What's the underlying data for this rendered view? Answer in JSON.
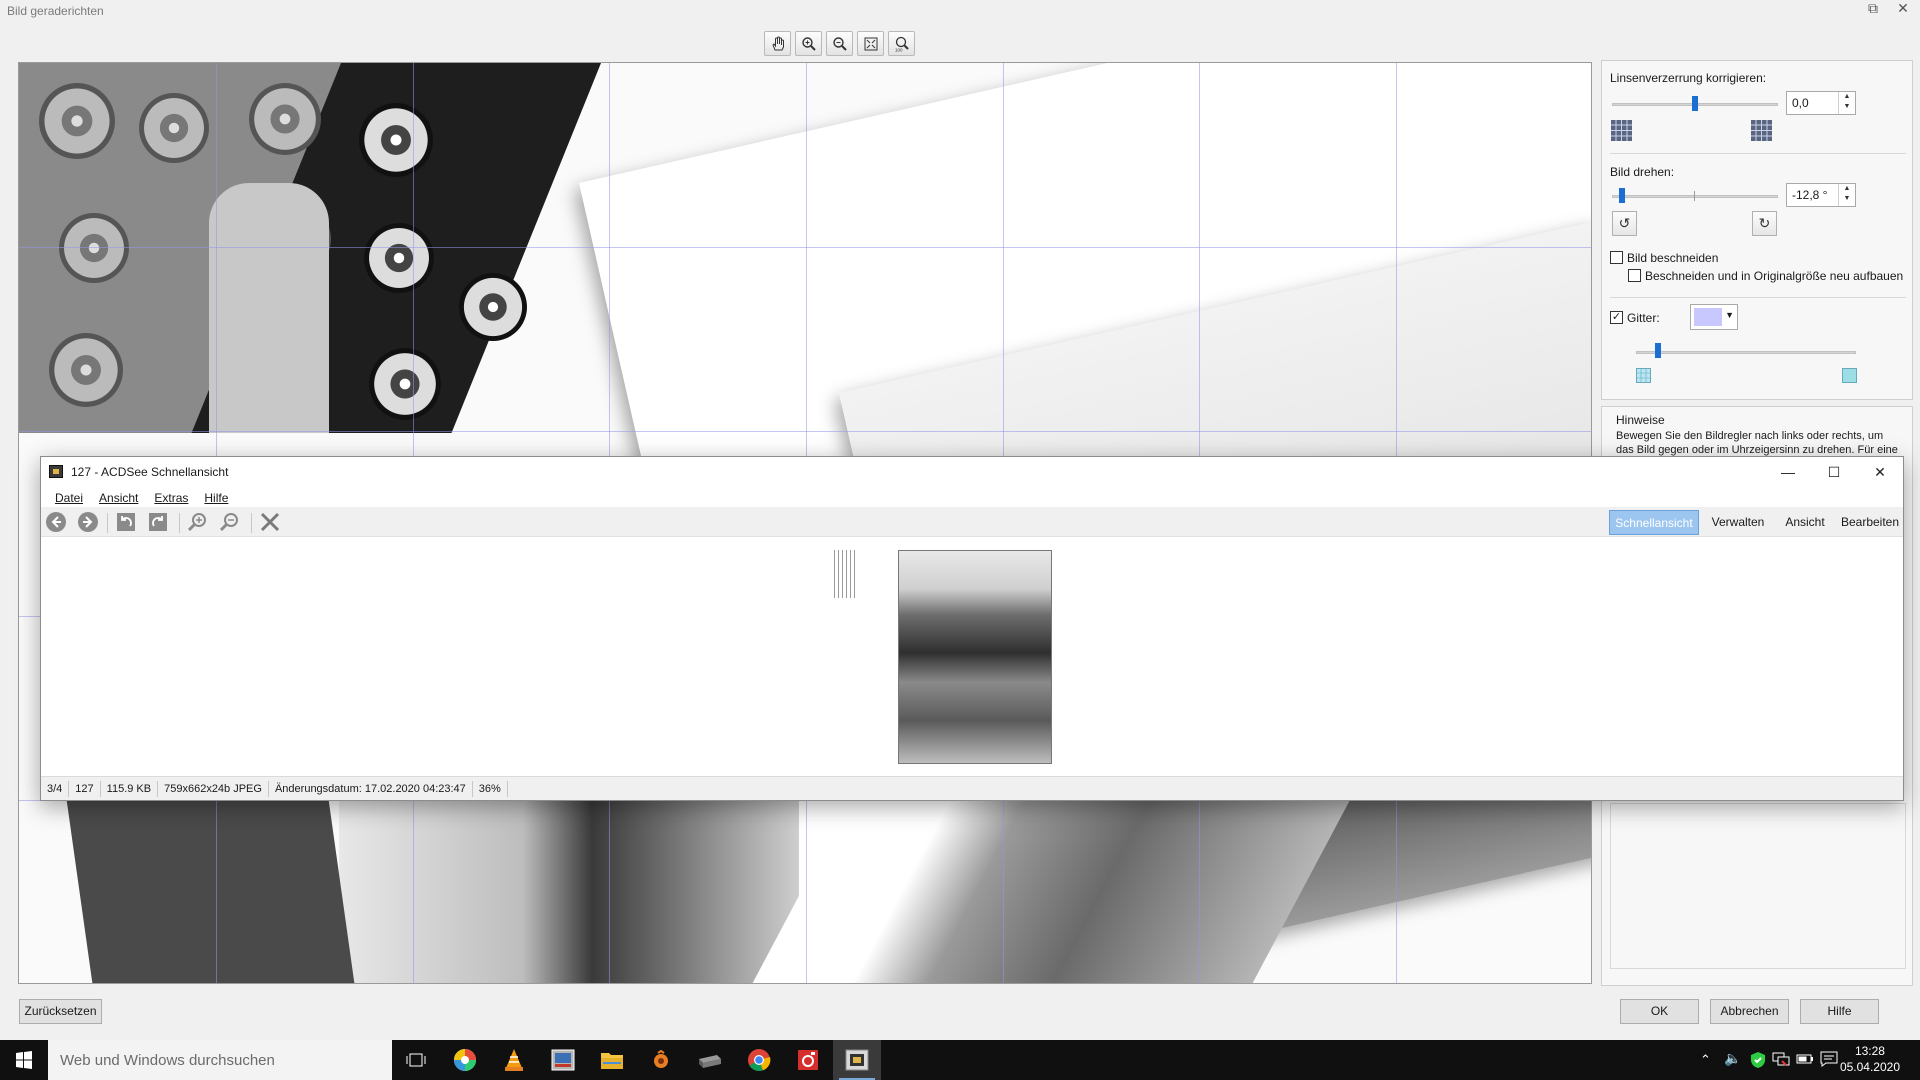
{
  "dialog": {
    "title": "Bild geraderichten",
    "window_buttons": [
      "restore",
      "close"
    ],
    "view_tools": [
      "hand-icon",
      "zoom-in-icon",
      "zoom-out-icon",
      "fit-icon",
      "actual-size-icon"
    ]
  },
  "settings": {
    "lens_label": "Linsenverzerrung korrigieren:",
    "lens_value": "0,0",
    "lens_slider": 0.5,
    "rotate_label": "Bild drehen:",
    "rotate_value": "-12,8 °",
    "rotate_slider": 0.06,
    "crop_label": "Bild beschneiden",
    "crop_checked": false,
    "crop_restore_label": "Beschneiden und in Originalgröße neu aufbauen",
    "crop_restore_checked": false,
    "grid_label": "Gitter:",
    "grid_checked": true,
    "grid_color": "#c8c8ff",
    "grid_slider": 0.1
  },
  "hints": {
    "title": "Hinweise",
    "text": "Bewegen Sie den Bildregler nach links oder rechts, um das Bild gegen oder im Uhrzeigersinn zu drehen. Für eine"
  },
  "buttons": {
    "reset": "Zurücksetzen",
    "ok": "OK",
    "cancel": "Abbrechen",
    "help": "Hilfe"
  },
  "acdsee": {
    "title": "127 - ACDSee Schnellansicht",
    "menu": [
      "Datei",
      "Ansicht",
      "Extras",
      "Hilfe"
    ],
    "tabs": [
      "Schnellansicht",
      "Verwalten",
      "Ansicht",
      "Bearbeiten"
    ],
    "active_tab": "Schnellansicht",
    "status": [
      "3/4",
      "127",
      "115.9 KB",
      "759x662x24b JPEG",
      "Änderungsdatum: 17.02.2020 04:23:47",
      "36%"
    ]
  },
  "taskbar": {
    "search_placeholder": "Web und Windows durchsuchen",
    "time": "13:28",
    "date": "05.04.2020"
  }
}
